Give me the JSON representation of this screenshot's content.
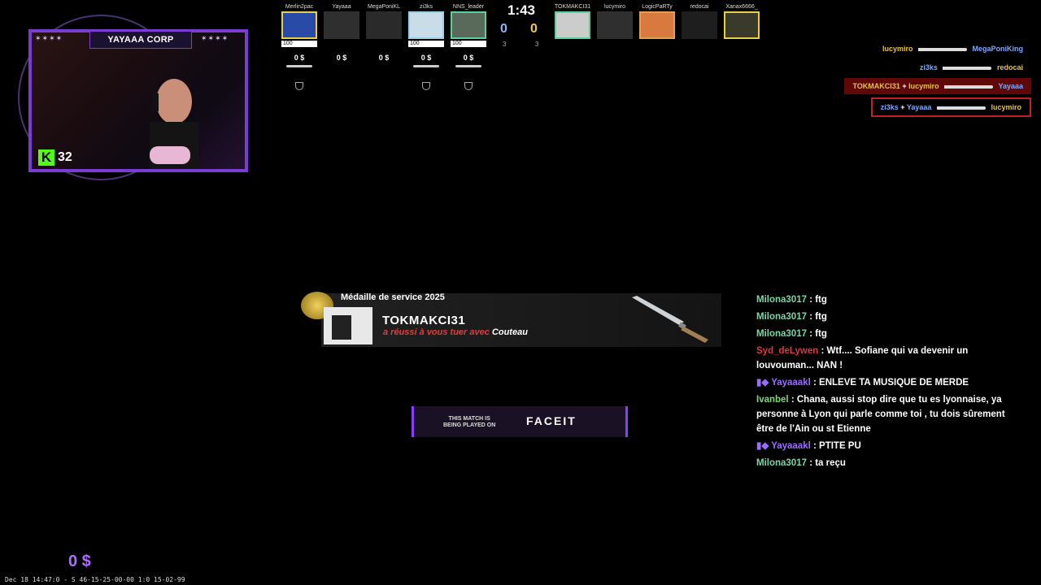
{
  "webcam": {
    "title": "YAYAAA CORP",
    "viewer_count": "32",
    "platform_icon": "kick-logo",
    "stars": "✶✶✶✶"
  },
  "hud": {
    "timer": "1:43",
    "score_ct": "0",
    "score_t": "0",
    "alive_ct": "3",
    "alive_t": "3",
    "ct_players": [
      {
        "name": "Merlin2pac",
        "hp": "100",
        "money": "0 $",
        "dead": false
      },
      {
        "name": "Yayaaa",
        "hp": "",
        "money": "0 $",
        "dead": true
      },
      {
        "name": "MegaPoniKL",
        "hp": "",
        "money": "0 $",
        "dead": true
      },
      {
        "name": "zi3ks",
        "hp": "100",
        "money": "0 $",
        "dead": false
      },
      {
        "name": "NNS_leader",
        "hp": "100",
        "money": "0 $",
        "dead": false
      }
    ],
    "t_players": [
      {
        "name": "TOKMAKCI31",
        "dead": false
      },
      {
        "name": "lucymiro",
        "dead": true
      },
      {
        "name": "LogicPaRTy",
        "dead": false
      },
      {
        "name": "redocai",
        "dead": true
      },
      {
        "name": "Xanax6666_",
        "dead": false
      }
    ]
  },
  "killfeed": [
    {
      "killer": "lucymiro",
      "killer_team": "t",
      "assist": "",
      "victim": "MegaPoniKing",
      "victim_team": "ct"
    },
    {
      "killer": "zi3ks",
      "killer_team": "ct",
      "assist": "",
      "victim": "redocai",
      "victim_team": "t"
    },
    {
      "killer": "TOKMAKCI31",
      "killer_team": "t",
      "assist": "lucymiro",
      "victim": "Yayaaa",
      "victim_team": "ct"
    },
    {
      "killer": "zi3ks",
      "killer_team": "ct",
      "assist": "Yayaaa",
      "victim": "lucymiro",
      "victim_team": "t"
    }
  ],
  "notification": {
    "medal": "Médaille de service 2025",
    "killer": "TOKMAKCI31",
    "message": "a réussi à vous tuer avec",
    "weapon": "Couteau"
  },
  "faceit": {
    "line1": "THIS MATCH IS",
    "line2": "BEING PLAYED ON",
    "logo": "FACEIT"
  },
  "chat": [
    {
      "user": "Milona3017",
      "color": "#7fd4a8",
      "text": ": ftg"
    },
    {
      "user": "Milona3017",
      "color": "#7fd4a8",
      "text": ": ftg"
    },
    {
      "user": "Milona3017",
      "color": "#7fd4a8",
      "text": ": ftg"
    },
    {
      "user": "Syd_deLywen",
      "color": "#e0363c",
      "text": ": Wtf.... Sofiane qui va devenir un louvouman... NAN !"
    },
    {
      "user": "Yayaaakl",
      "color": "#9b6cff",
      "text": ": ENLEVE TA MUSIQUE DE MERDE"
    },
    {
      "user": "Ivanbel",
      "color": "#7fd97a",
      "text": ": Chana, aussi stop dire que tu es lyonnaise, ya personne à Lyon qui parle comme toi , tu dois sûrement être de l'Ain ou st Etienne"
    },
    {
      "user": "Yayaaakl",
      "color": "#9b6cff",
      "text": ": PTITE PU"
    },
    {
      "user": "Milona3017",
      "color": "#7fd4a8",
      "text": ": ta reçu"
    }
  ],
  "my_money": "0 $",
  "timestamp": "Dec 18 14:47:0 - S 46-15-25-00-00 1:0 15-02-99"
}
